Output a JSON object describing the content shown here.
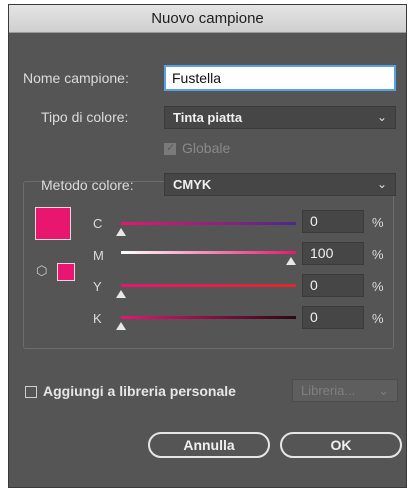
{
  "dialog": {
    "title": "Nuovo campione",
    "name_label": "Nome campione:",
    "name_value": "Fustella",
    "color_type_label": "Tipo di colore:",
    "color_type_value": "Tinta piatta",
    "global_label": "Globale",
    "global_checked": true,
    "color_mode_label": "Metodo colore:",
    "color_mode_value": "CMYK",
    "swatch_color": "#e8166f",
    "channels": [
      {
        "label": "C",
        "value": "0",
        "unit": "%"
      },
      {
        "label": "M",
        "value": "100",
        "unit": "%"
      },
      {
        "label": "Y",
        "value": "0",
        "unit": "%"
      },
      {
        "label": "K",
        "value": "0",
        "unit": "%"
      }
    ],
    "add_library_label": "Aggiungi a libreria personale",
    "add_library_checked": false,
    "library_value": "Libreria...",
    "cancel_label": "Annulla",
    "ok_label": "OK",
    "chevron_glyph": "⌄",
    "gamut_icon_glyph": "⬡"
  }
}
